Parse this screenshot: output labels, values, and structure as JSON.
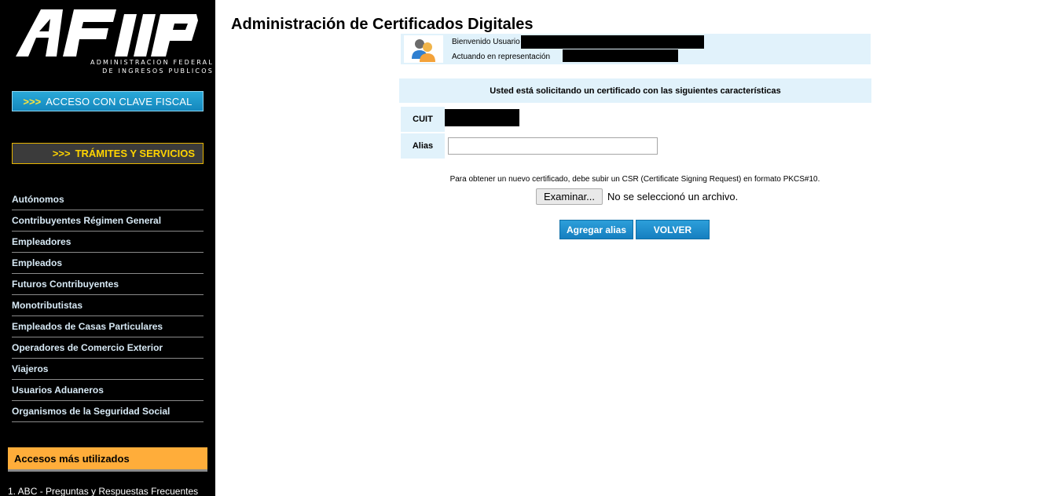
{
  "sidebar": {
    "logo_subtitle_line1": "ADMINISTRACION FEDERAL",
    "logo_subtitle_line2": "DE INGRESOS PUBLICOS",
    "clave_fiscal": {
      "arrows": ">>>",
      "label": "ACCESO CON CLAVE FISCAL"
    },
    "tramites": {
      "arrows": ">>>",
      "label": "TRÁMITES Y SERVICIOS"
    },
    "nav_items": [
      "Autónomos",
      "Contribuyentes Régimen General",
      "Empleadores",
      "Empleados",
      "Futuros Contribuyentes",
      "Monotributistas",
      "Empleados de Casas Particulares",
      "Operadores de Comercio Exterior",
      "Viajeros",
      "Usuarios Aduaneros",
      "Organismos de la Seguridad Social"
    ],
    "accesos_title": "Accesos más utilizados",
    "faq_link": "1. ABC - Preguntas y Respuestas Frecuentes"
  },
  "main": {
    "title": "Administración de Certificados Digitales",
    "user": {
      "welcome": "Bienvenido Usuario",
      "acting": "Actuando en representación"
    },
    "info_text": "Usted está solicitando un certificado con las siguientes características",
    "cuit_label": "CUIT",
    "alias_label": "Alias",
    "alias_value": "",
    "csr_note": "Para obtener un nuevo certificado, debe subir un CSR (Certificate Signing Request) en formato PKCS#10.",
    "file_button": "Examinar...",
    "file_status": "No se seleccionó un archivo.",
    "btn_add_alias": "Agregar alias",
    "btn_back": "VOLVER"
  },
  "colors": {
    "sidebar_bg": "#000000",
    "panel_bg": "#e1f2fb",
    "accent_blue": "#1e90d0",
    "accent_orange": "#ffad3a",
    "accent_yellow": "#ffd400"
  }
}
